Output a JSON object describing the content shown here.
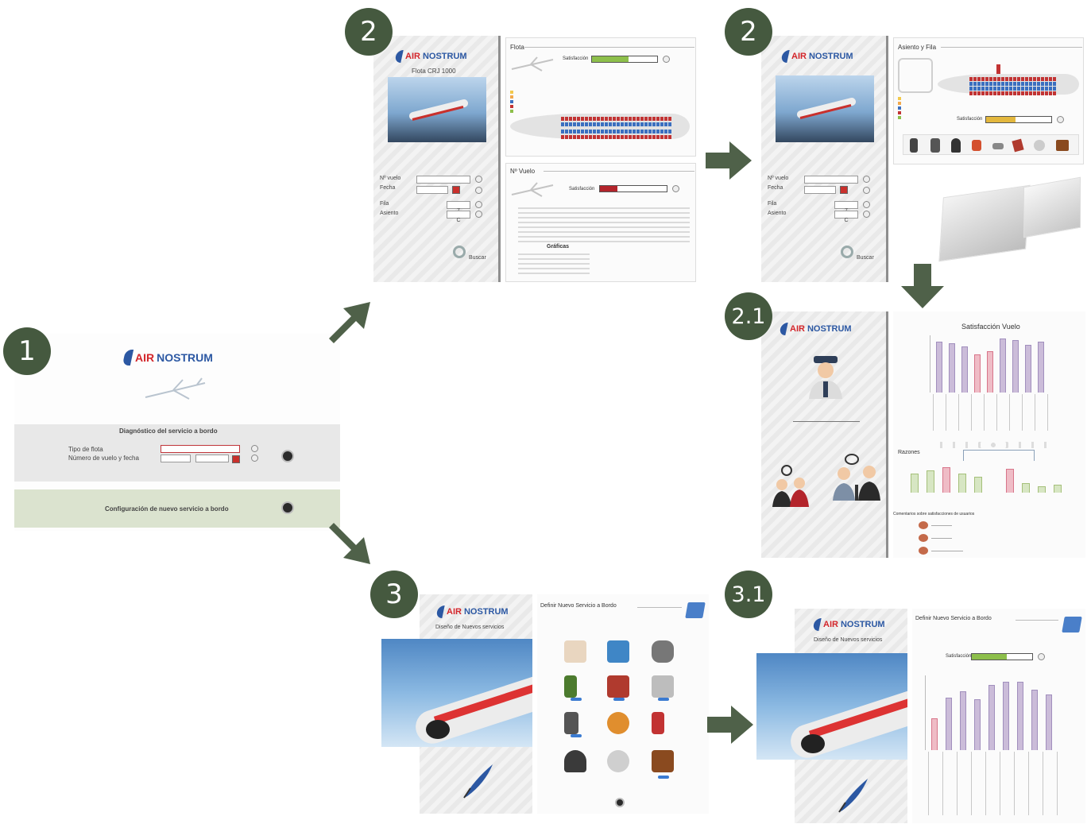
{
  "badges": [
    "1",
    "2",
    "2",
    "2.1",
    "3",
    "3.1"
  ],
  "brand": {
    "air": "AIR",
    "nostrum": "NOSTRUM"
  },
  "screen1": {
    "heading": "Diagnóstico del servicio a bordo",
    "field1_label": "Tipo de flota",
    "field2_label": "Número de vuelo y fecha",
    "config_label": "Configuración de nuevo servicio a bordo"
  },
  "screen2a": {
    "flota_title": "Flota CRJ 1000",
    "form": [
      "Nº vuelo",
      "Fecha",
      "Fila",
      "Asiento"
    ],
    "row_value": "7",
    "seat_value": "C",
    "search_label": "Buscar",
    "tab_flota": "Flota",
    "tab_vuelo": "Nº Vuelo",
    "satisfaction_label": "Satisfacción",
    "stats_title": "Gráficas"
  },
  "screen2b": {
    "tab_title": "Asiento y Fila",
    "satisfaction_label": "Satisfacción"
  },
  "screen21": {
    "chart_title": "Satisfacción Vuelo",
    "reasons_label": "Razones",
    "comments_label": "Comentarios sobre satisfacciones de usuarios"
  },
  "screen3": {
    "subtitle": "Diseño de Nuevos servicios",
    "tab_title": "Definir Nuevo Servicio a Bordo"
  },
  "screen31": {
    "subtitle": "Diseño de Nuevos servicios",
    "tab_title": "Definir Nuevo Servicio a Bordo",
    "satisfaction_label": "Satisfacción"
  },
  "colors": {
    "badge": "#45593f",
    "arrow": "#4f6149",
    "brand_red": "#d3262b",
    "brand_blue": "#2c58a3",
    "sat_green": "#8dbf4b",
    "sat_red": "#b3242b"
  }
}
